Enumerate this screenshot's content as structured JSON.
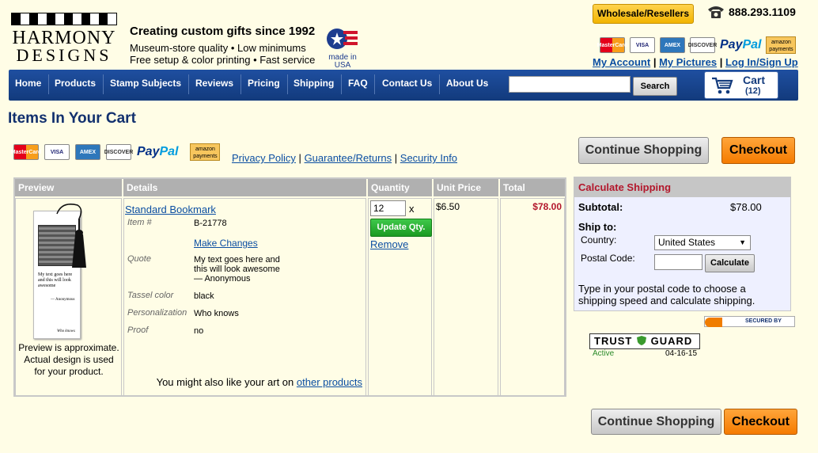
{
  "header": {
    "logo_line1": "HARMONY",
    "logo_line2": "DESIGNS",
    "tagline": "Creating custom gifts since 1992",
    "tagline2": "Museum-store quality • Low minimums",
    "tagline3": "Free setup & color printing • Fast service",
    "made_in_usa": "made in USA",
    "wholesale_label": "Wholesale/Resellers",
    "phone": "888.293.1109",
    "payment_icons": [
      "mastercard-icon",
      "visa-icon",
      "amex-icon",
      "discover-icon",
      "paypal-logo",
      "amazon-payments-icon"
    ],
    "card_labels": {
      "mastercard": "MasterCard",
      "visa": "VISA",
      "amex": "AMEX",
      "discover": "DISCOVER",
      "paypal_a": "Pay",
      "paypal_b": "Pal",
      "amazon": "amazon payments"
    },
    "account_links": {
      "my_account": "My Account",
      "my_pictures": "My Pictures",
      "login": "Log In/Sign Up",
      "sep": "|"
    }
  },
  "nav": {
    "items": [
      "Home",
      "Products",
      "Stamp Subjects",
      "Reviews",
      "Pricing",
      "Shipping",
      "FAQ",
      "Contact Us",
      "About Us"
    ],
    "search_value": "",
    "search_button": "Search",
    "cart_label": "Cart",
    "cart_count": "(12)"
  },
  "page": {
    "title": "Items In Your Cart",
    "policy_links": [
      "Privacy Policy",
      "Guarantee/Returns",
      "Security Info"
    ],
    "continue_label": "Continue Shopping",
    "checkout_label": "Checkout"
  },
  "cart": {
    "headers": {
      "preview": "Preview",
      "details": "Details",
      "quantity": "Quantity",
      "unit_price": "Unit Price",
      "total": "Total"
    },
    "item": {
      "name": "Standard Bookmark",
      "item_label": "Item #",
      "item_number": "B-21778",
      "make_changes": "Make Changes",
      "quote_label": "Quote",
      "quote_line1": "My text goes here and",
      "quote_line2": "this will look awesome",
      "quote_line3": "— Anonymous",
      "tassel_label": "Tassel color",
      "tassel_value": "black",
      "personalization_label": "Personalization",
      "personalization_value": "Who knows",
      "proof_label": "Proof",
      "proof_value": "no",
      "quantity": "12",
      "quantity_x": "x",
      "update_label": "Update Qty.",
      "remove_label": "Remove",
      "unit_price": "$6.50",
      "total": "$78.00",
      "preview_note": "Preview is approximate. Actual design is used for your product.",
      "bookmark_text": "My text goes here and this will look awesome",
      "bookmark_author": "— Anonymous",
      "bookmark_sign": "Who knows"
    },
    "upsell_text": "You might also like your art on",
    "upsell_link": "other products"
  },
  "shipping": {
    "title": "Calculate Shipping",
    "subtotal_label": "Subtotal:",
    "subtotal_value": "$78.00",
    "ship_to": "Ship to:",
    "country_label": "Country:",
    "country_value": "United States",
    "postal_label": "Postal Code:",
    "postal_value": "",
    "calculate_label": "Calculate",
    "note": "Type in your postal code to choose a shipping speed and calculate shipping."
  },
  "badges": {
    "secured_by": "SECURED BY",
    "trust_brand_a": "TRUST",
    "trust_brand_b": "GUARD",
    "trust_status": "Active",
    "trust_date": "04-16-15"
  },
  "colors": {
    "nav": "#1a4590",
    "checkout": "#f98b1a",
    "update": "#2aa733",
    "total": "#b3172c"
  }
}
